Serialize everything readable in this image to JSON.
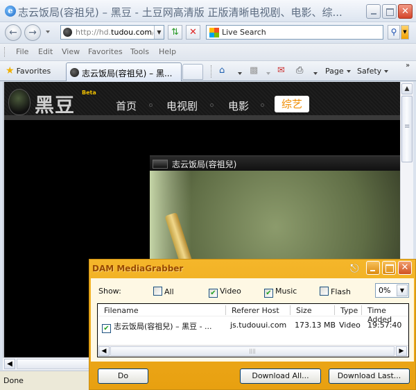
{
  "window": {
    "title": "志云饭局(容祖兒) – 黑豆 - 土豆网高清版 正版清晰电视剧、电影、综..."
  },
  "navbar": {
    "address": {
      "prefix": "http://hd.",
      "domain": "tudou.com",
      "suffix": "/p"
    },
    "search_placeholder": "Live Search"
  },
  "menu": [
    "File",
    "Edit",
    "View",
    "Favorites",
    "Tools",
    "Help"
  ],
  "favbar": {
    "favorites_label": "Favorites",
    "tab_label": "志云饭局(容祖兒) – 黑...",
    "tools": {
      "page": "Page",
      "safety": "Safety"
    }
  },
  "site": {
    "logo": "黑豆",
    "beta": "Beta",
    "nav": [
      "首页",
      "电视剧",
      "电影",
      "综艺"
    ],
    "active_nav": "综艺",
    "player_title": "志云饭局(容祖兒)"
  },
  "status": {
    "text": "Done"
  },
  "grabber": {
    "title": "DAM MediaGrabber",
    "show_label": "Show:",
    "filters": [
      {
        "label": "All",
        "checked": false
      },
      {
        "label": "Video",
        "checked": true
      },
      {
        "label": "Music",
        "checked": true
      },
      {
        "label": "Flash",
        "checked": false
      }
    ],
    "percent": "0%",
    "columns": [
      "Filename",
      "Referer Host",
      "Size",
      "Type",
      "Time Added"
    ],
    "rows": [
      {
        "checked": true,
        "filename": "志云饭局(容祖兒) – 黑豆 - ...",
        "host": "js.tudouui.com",
        "size": "173.13 MB",
        "type": "Video",
        "time": "19:57:40"
      }
    ],
    "buttons": {
      "do": "Do",
      "download_all": "Download All...",
      "download_last": "Download Last..."
    }
  }
}
